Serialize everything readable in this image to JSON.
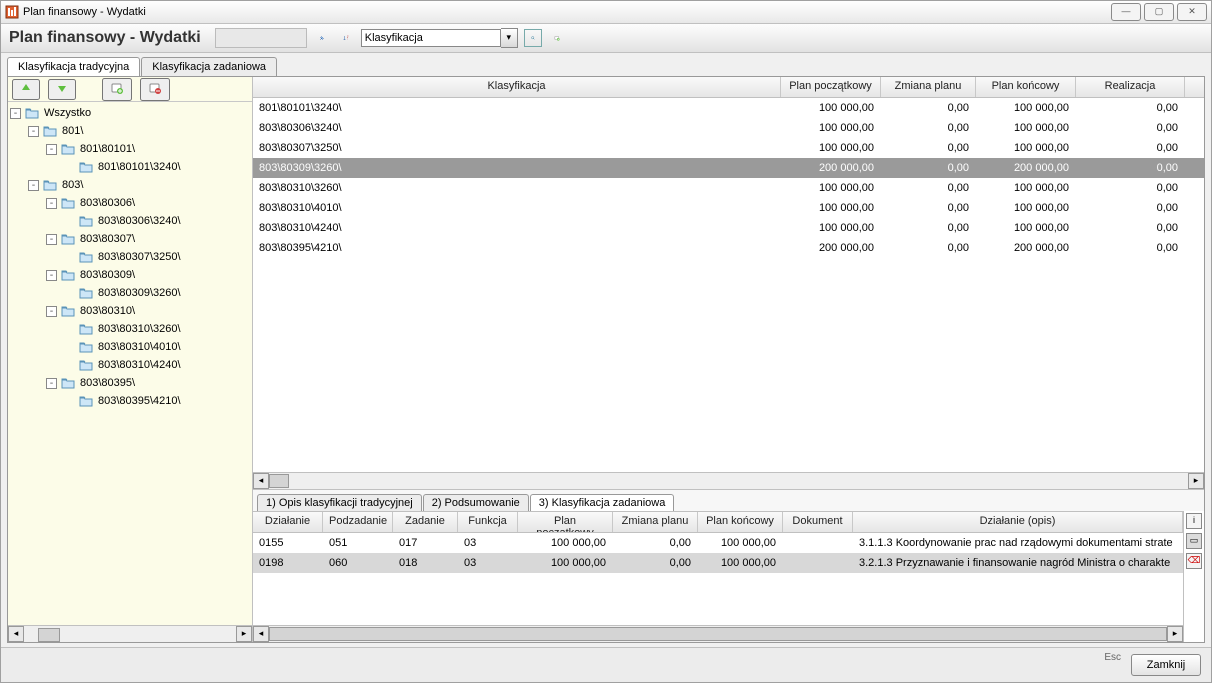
{
  "window": {
    "title": "Plan finansowy - Wydatki",
    "heading": "Plan finansowy - Wydatki"
  },
  "toolbar": {
    "filter_field": "Klasyfikacja"
  },
  "tabs": [
    {
      "label": "Klasyfikacja tradycyjna",
      "active": true
    },
    {
      "label": "Klasyfikacja zadaniowa",
      "active": false
    }
  ],
  "tree": {
    "root": "Wszystko",
    "nodes": [
      {
        "depth": 0,
        "toggle": "-",
        "label": "Wszystko",
        "icon": "folder"
      },
      {
        "depth": 1,
        "toggle": "-",
        "label": "801\\"
      },
      {
        "depth": 2,
        "toggle": "-",
        "label": "801\\80101\\"
      },
      {
        "depth": 3,
        "toggle": "",
        "label": "801\\80101\\3240\\"
      },
      {
        "depth": 1,
        "toggle": "-",
        "label": "803\\"
      },
      {
        "depth": 2,
        "toggle": "-",
        "label": "803\\80306\\"
      },
      {
        "depth": 3,
        "toggle": "",
        "label": "803\\80306\\3240\\"
      },
      {
        "depth": 2,
        "toggle": "-",
        "label": "803\\80307\\"
      },
      {
        "depth": 3,
        "toggle": "",
        "label": "803\\80307\\3250\\"
      },
      {
        "depth": 2,
        "toggle": "-",
        "label": "803\\80309\\"
      },
      {
        "depth": 3,
        "toggle": "",
        "label": "803\\80309\\3260\\"
      },
      {
        "depth": 2,
        "toggle": "-",
        "label": "803\\80310\\"
      },
      {
        "depth": 3,
        "toggle": "",
        "label": "803\\80310\\3260\\"
      },
      {
        "depth": 3,
        "toggle": "",
        "label": "803\\80310\\4010\\"
      },
      {
        "depth": 3,
        "toggle": "",
        "label": "803\\80310\\4240\\"
      },
      {
        "depth": 2,
        "toggle": "-",
        "label": "803\\80395\\"
      },
      {
        "depth": 3,
        "toggle": "",
        "label": "803\\80395\\4210\\"
      }
    ]
  },
  "grid": {
    "headers": {
      "klas": "Klasyfikacja",
      "pp": "Plan początkowy",
      "zm": "Zmiana planu",
      "pk": "Plan końcowy",
      "re": "Realizacja"
    },
    "rows": [
      {
        "klas": "801\\80101\\3240\\",
        "pp": "100 000,00",
        "zm": "0,00",
        "pk": "100 000,00",
        "re": "0,00",
        "sel": false
      },
      {
        "klas": "803\\80306\\3240\\",
        "pp": "100 000,00",
        "zm": "0,00",
        "pk": "100 000,00",
        "re": "0,00",
        "sel": false
      },
      {
        "klas": "803\\80307\\3250\\",
        "pp": "100 000,00",
        "zm": "0,00",
        "pk": "100 000,00",
        "re": "0,00",
        "sel": false
      },
      {
        "klas": "803\\80309\\3260\\",
        "pp": "200 000,00",
        "zm": "0,00",
        "pk": "200 000,00",
        "re": "0,00",
        "sel": true
      },
      {
        "klas": "803\\80310\\3260\\",
        "pp": "100 000,00",
        "zm": "0,00",
        "pk": "100 000,00",
        "re": "0,00",
        "sel": false
      },
      {
        "klas": "803\\80310\\4010\\",
        "pp": "100 000,00",
        "zm": "0,00",
        "pk": "100 000,00",
        "re": "0,00",
        "sel": false
      },
      {
        "klas": "803\\80310\\4240\\",
        "pp": "100 000,00",
        "zm": "0,00",
        "pk": "100 000,00",
        "re": "0,00",
        "sel": false
      },
      {
        "klas": "803\\80395\\4210\\",
        "pp": "200 000,00",
        "zm": "0,00",
        "pk": "200 000,00",
        "re": "0,00",
        "sel": false
      }
    ]
  },
  "subtabs": [
    {
      "label": "1) Opis klasyfikacji tradycyjnej",
      "active": false
    },
    {
      "label": "2) Podsumowanie",
      "active": false
    },
    {
      "label": "3) Klasyfikacja zadaniowa",
      "active": true
    }
  ],
  "detail": {
    "headers": {
      "dz": "Działanie",
      "pod": "Podzadanie",
      "zad": "Zadanie",
      "fun": "Funkcja",
      "pp": "Plan początkowy",
      "zm": "Zmiana planu",
      "pk": "Plan końcowy",
      "dok": "Dokument",
      "opis": "Działanie (opis)"
    },
    "rows": [
      {
        "dz": "0155",
        "pod": "051",
        "zad": "017",
        "fun": "03",
        "pp": "100 000,00",
        "zm": "0,00",
        "pk": "100 000,00",
        "dok": "",
        "opis": "3.1.1.3 Koordynowanie prac nad rządowymi dokumentami strate",
        "sel": false
      },
      {
        "dz": "0198",
        "pod": "060",
        "zad": "018",
        "fun": "03",
        "pp": "100 000,00",
        "zm": "0,00",
        "pk": "100 000,00",
        "dok": "",
        "opis": "3.2.1.3 Przyznawanie i finansowanie nagród Ministra o charakte",
        "sel": true
      }
    ]
  },
  "footer": {
    "esc": "Esc",
    "close": "Zamknij"
  }
}
